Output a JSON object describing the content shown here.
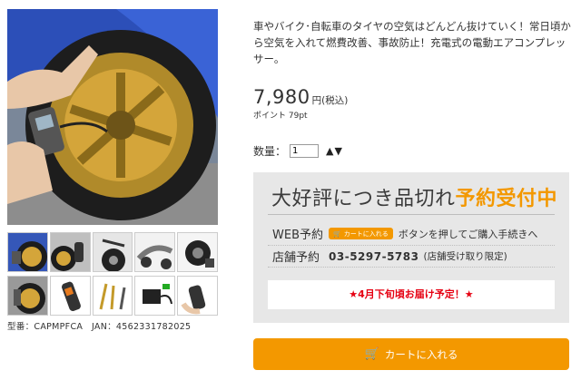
{
  "product": {
    "description": "車やバイク･自転車のタイヤの空気はどんどん抜けていく！常日頃から空気を入れて燃費改善、事故防止！充電式の電動エアコンプレッサー。",
    "price": "7,980",
    "price_unit": "円(税込)",
    "points": "ポイント 79pt",
    "model_line": "型番：CAPMPFCA　JAN：4562331782025"
  },
  "quantity": {
    "label": "数量：",
    "value": "1",
    "arrows": "▲▼"
  },
  "reservation": {
    "title_prefix": "大好評につき品切れ",
    "title_highlight": "予約受付中",
    "web_label": "WEB予約",
    "web_button": "カートに入れる",
    "web_text": "ボタンを押してご購入手続きへ",
    "store_label": "店舗予約",
    "store_phone": "03-5297-5783",
    "store_note": "(店舗受け取り限定)",
    "delivery_note": "★4月下旬頃お届け予定！★"
  },
  "cart_button": {
    "label": "カートに入れる",
    "icon": "cart-icon"
  },
  "colors": {
    "accent": "#f39800",
    "alert": "#e60012",
    "panel": "#e7e7e7"
  }
}
